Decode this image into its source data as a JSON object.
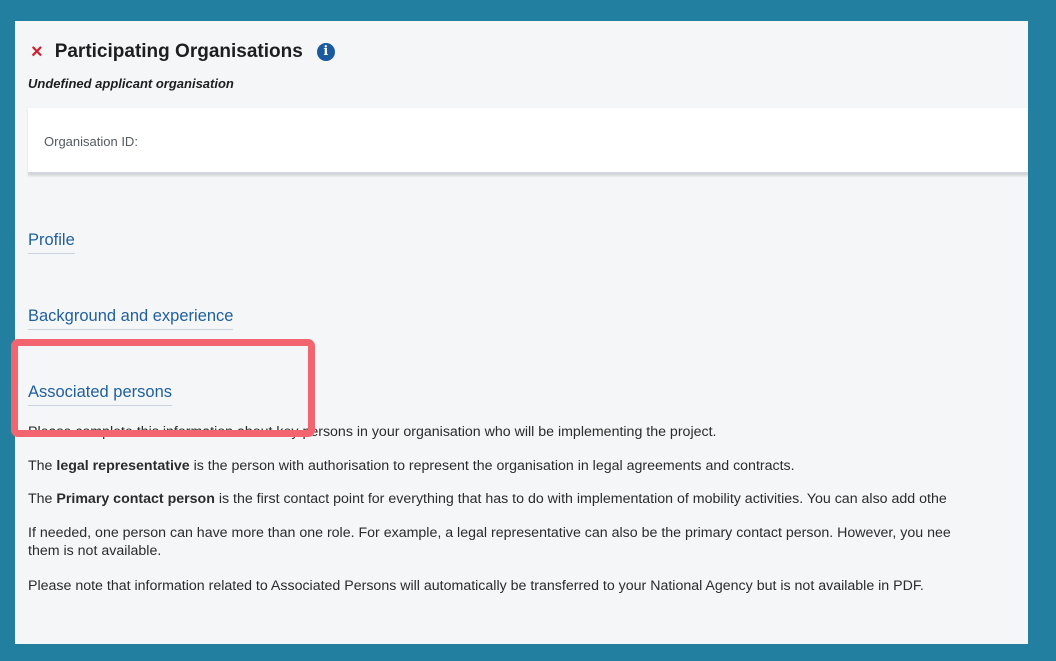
{
  "header": {
    "title": "Participating Organisations",
    "close_icon": "×",
    "info_icon": "i",
    "subtitle": "Undefined applicant organisation"
  },
  "org_card": {
    "label": "Organisation ID:"
  },
  "sections": {
    "profile": "Profile",
    "background": "Background and experience",
    "associated": "Associated persons"
  },
  "body": {
    "p1": "Please complete this information about key persons in your organisation who will be implementing the project.",
    "p2_pre": "The ",
    "p2_bold": "legal representative",
    "p2_post": " is the person with authorisation to represent the organisation in legal agreements and contracts.",
    "p3_pre": "The ",
    "p3_bold": "Primary contact person",
    "p3_post": " is the first contact point for everything that has to do with implementation of mobility activities. You can also add othe",
    "p4_line1": "If needed, one person can have more than one role. For example, a legal representative can also be the primary contact person. However, you nee",
    "p4_line2": "them is not available.",
    "p5": "Please note that information related to Associated Persons will automatically be transferred to your National Agency but is not available in PDF."
  },
  "colors": {
    "background": "#237fa0",
    "panel": "#f5f6f7",
    "link": "#1f5f9e",
    "highlight": "#f2646e",
    "close_icon": "#d11f2f",
    "info_icon": "#1a5a9e"
  }
}
